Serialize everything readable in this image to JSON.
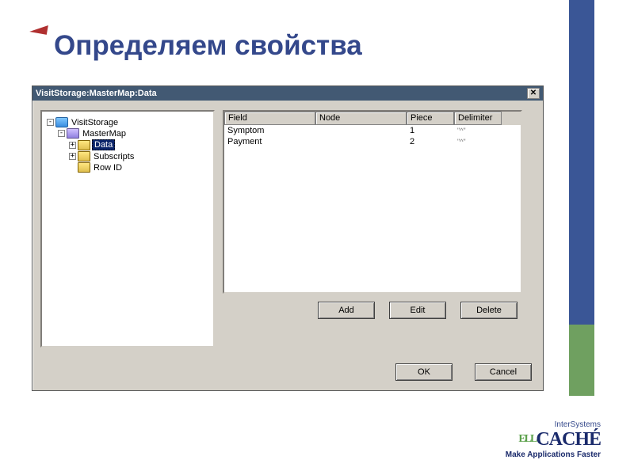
{
  "slide": {
    "title": "Определяем свойства"
  },
  "dialog": {
    "title": "VisitStorage:MasterMap:Data",
    "close": "✕"
  },
  "tree": {
    "root": {
      "label": "VisitStorage",
      "expander": "-"
    },
    "mastermap": {
      "label": "MasterMap",
      "expander": "-"
    },
    "data": {
      "label": "Data",
      "expander": "+"
    },
    "subscripts": {
      "label": "Subscripts",
      "expander": "+"
    },
    "rowid": {
      "label": "Row ID",
      "expander": ""
    }
  },
  "columns": {
    "field": "Field",
    "node": "Node",
    "piece": "Piece",
    "delimiter": "Delimiter"
  },
  "rows": [
    {
      "field": "Symptom",
      "node": "",
      "piece": "1",
      "delimiter": "\"^\""
    },
    {
      "field": "Payment",
      "node": "",
      "piece": "2",
      "delimiter": "\"^\""
    }
  ],
  "buttons": {
    "add": "Add",
    "edit": "Edit",
    "delete": "Delete",
    "ok": "OK",
    "cancel": "Cancel"
  },
  "logo": {
    "top": "InterSystems",
    "mid_prefix": "ELL",
    "mid": "CACHÉ",
    "bottom": "Make Applications Faster"
  }
}
